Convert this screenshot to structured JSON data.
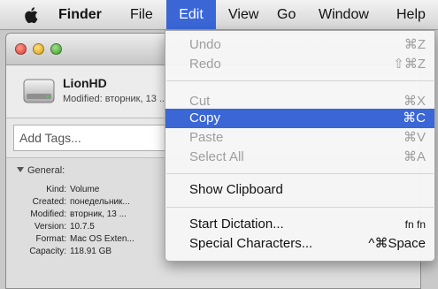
{
  "menubar": {
    "apple_icon": "apple-icon",
    "items": [
      "Finder",
      "File",
      "Edit",
      "View",
      "Go",
      "Window",
      "Help"
    ],
    "active": "Edit",
    "highlight_color": "#3a66d6"
  },
  "window": {
    "disk_name": "LionHD",
    "modified": "Modified: вторник, 13 ...",
    "tags_placeholder": "Add Tags...",
    "general": {
      "title": "General:",
      "rows": [
        {
          "label": "Kind:",
          "value": "Volume"
        },
        {
          "label": "Created:",
          "value": "понедельник..."
        },
        {
          "label": "Modified:",
          "value": "вторник, 13 ..."
        },
        {
          "label": "Version:",
          "value": "10.7.5"
        },
        {
          "label": "Format:",
          "value": "Mac OS Exten..."
        },
        {
          "label": "Capacity:",
          "value": "118.91 GB"
        }
      ]
    }
  },
  "edit_menu": {
    "items": [
      {
        "label": "Undo",
        "shortcut": "⌘Z",
        "state": "disabled"
      },
      {
        "label": "Redo",
        "shortcut": "⇧⌘Z",
        "state": "disabled"
      },
      {
        "label": "Cut",
        "shortcut": "⌘X",
        "state": "disabled"
      },
      {
        "label": "Copy",
        "shortcut": "⌘C",
        "state": "highlighted"
      },
      {
        "label": "Paste",
        "shortcut": "⌘V",
        "state": "disabled"
      },
      {
        "label": "Select All",
        "shortcut": "⌘A",
        "state": "disabled"
      },
      {
        "label": "Show Clipboard",
        "shortcut": "",
        "state": "enabled"
      },
      {
        "label": "Start Dictation...",
        "shortcut": "fn fn",
        "state": "enabled"
      },
      {
        "label": "Special Characters...",
        "shortcut": "^⌘Space",
        "state": "enabled"
      }
    ]
  }
}
